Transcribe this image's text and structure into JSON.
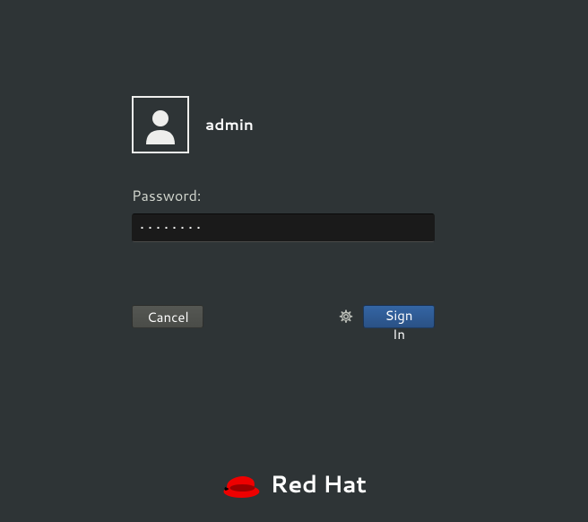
{
  "user": {
    "name": "admin"
  },
  "form": {
    "password_label": "Password:",
    "password_value": "••••••••"
  },
  "buttons": {
    "cancel": "Cancel",
    "signin": "Sign In"
  },
  "branding": {
    "vendor": "Red Hat",
    "hat_color": "#ee0000"
  }
}
